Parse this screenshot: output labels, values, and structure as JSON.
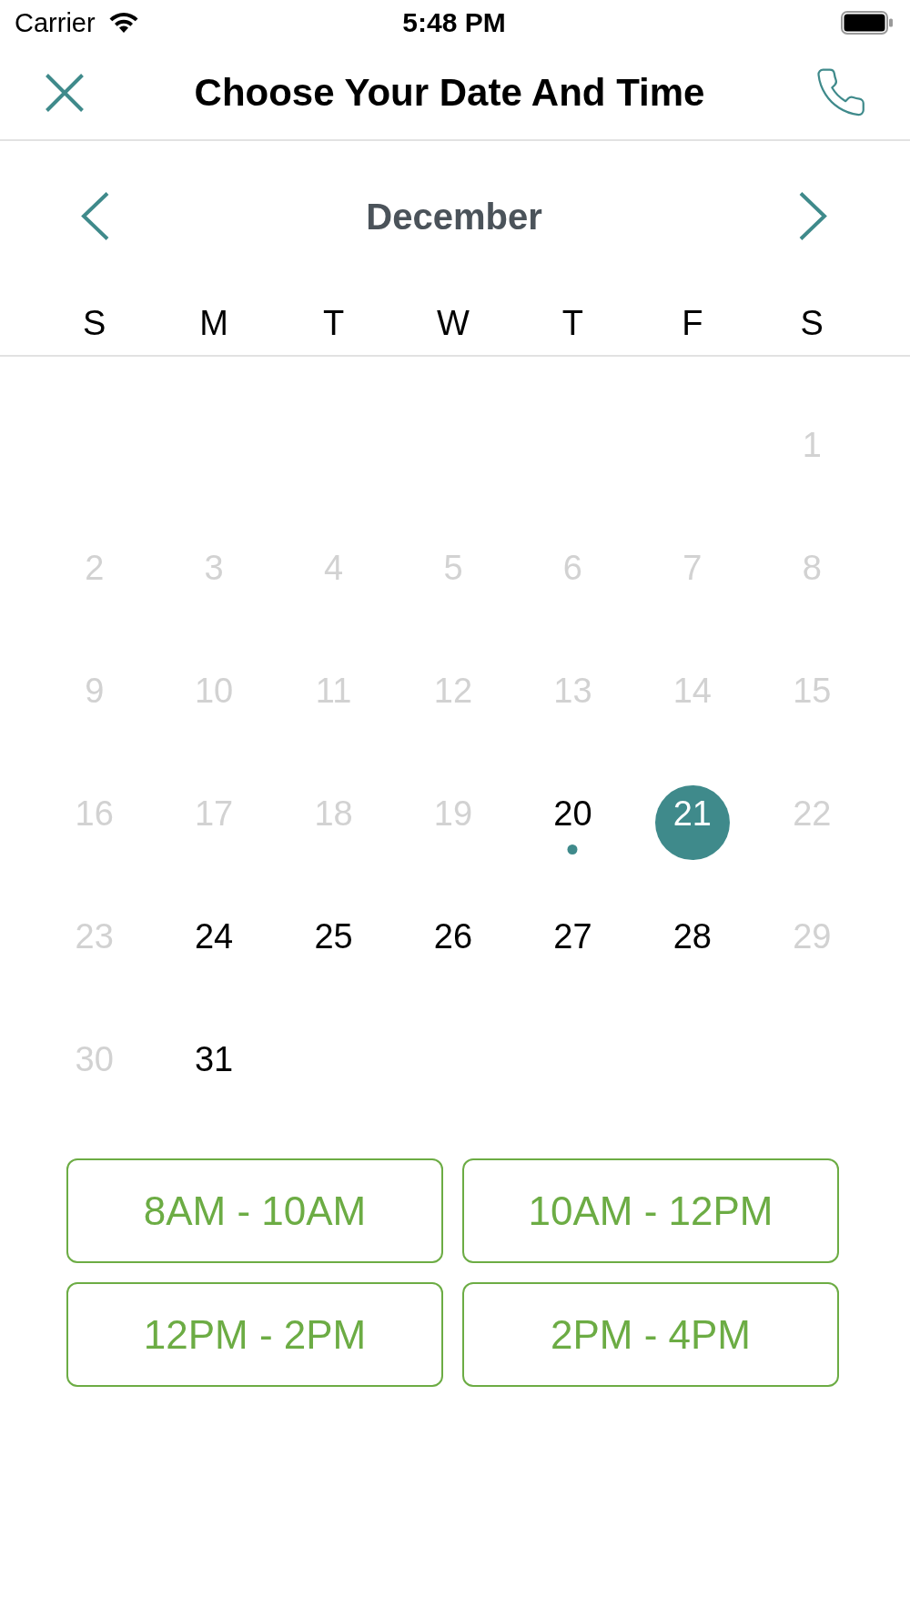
{
  "status_bar": {
    "carrier": "Carrier",
    "time": "5:48 PM"
  },
  "header": {
    "title": "Choose Your Date And Time"
  },
  "calendar": {
    "month": "December",
    "weekdays": [
      "S",
      "M",
      "T",
      "W",
      "T",
      "F",
      "S"
    ],
    "weeks": [
      {
        "days": [
          {
            "label": "1",
            "disabled": true,
            "selected": false,
            "today": false
          }
        ]
      },
      {
        "days": [
          {
            "label": "2",
            "disabled": true,
            "selected": false,
            "today": false
          },
          {
            "label": "3",
            "disabled": true,
            "selected": false,
            "today": false
          },
          {
            "label": "4",
            "disabled": true,
            "selected": false,
            "today": false
          },
          {
            "label": "5",
            "disabled": true,
            "selected": false,
            "today": false
          },
          {
            "label": "6",
            "disabled": true,
            "selected": false,
            "today": false
          },
          {
            "label": "7",
            "disabled": true,
            "selected": false,
            "today": false
          },
          {
            "label": "8",
            "disabled": true,
            "selected": false,
            "today": false
          }
        ]
      },
      {
        "days": [
          {
            "label": "9",
            "disabled": true,
            "selected": false,
            "today": false
          },
          {
            "label": "10",
            "disabled": true,
            "selected": false,
            "today": false
          },
          {
            "label": "11",
            "disabled": true,
            "selected": false,
            "today": false
          },
          {
            "label": "12",
            "disabled": true,
            "selected": false,
            "today": false
          },
          {
            "label": "13",
            "disabled": true,
            "selected": false,
            "today": false
          },
          {
            "label": "14",
            "disabled": true,
            "selected": false,
            "today": false
          },
          {
            "label": "15",
            "disabled": true,
            "selected": false,
            "today": false
          }
        ]
      },
      {
        "days": [
          {
            "label": "16",
            "disabled": true,
            "selected": false,
            "today": false
          },
          {
            "label": "17",
            "disabled": true,
            "selected": false,
            "today": false
          },
          {
            "label": "18",
            "disabled": true,
            "selected": false,
            "today": false
          },
          {
            "label": "19",
            "disabled": true,
            "selected": false,
            "today": false
          },
          {
            "label": "20",
            "disabled": false,
            "selected": false,
            "today": true
          },
          {
            "label": "21",
            "disabled": false,
            "selected": true,
            "today": false
          },
          {
            "label": "22",
            "disabled": true,
            "selected": false,
            "today": false
          }
        ]
      },
      {
        "days": [
          {
            "label": "23",
            "disabled": true,
            "selected": false,
            "today": false
          },
          {
            "label": "24",
            "disabled": false,
            "selected": false,
            "today": false
          },
          {
            "label": "25",
            "disabled": false,
            "selected": false,
            "today": false
          },
          {
            "label": "26",
            "disabled": false,
            "selected": false,
            "today": false
          },
          {
            "label": "27",
            "disabled": false,
            "selected": false,
            "today": false
          },
          {
            "label": "28",
            "disabled": false,
            "selected": false,
            "today": false
          },
          {
            "label": "29",
            "disabled": true,
            "selected": false,
            "today": false
          }
        ]
      },
      {
        "days": [
          {
            "label": "30",
            "disabled": true,
            "selected": false,
            "today": false
          },
          {
            "label": "31",
            "disabled": false,
            "selected": false,
            "today": false
          }
        ]
      }
    ]
  },
  "time_slots": [
    {
      "label": "8AM - 10AM",
      "selected": false
    },
    {
      "label": "10AM - 12PM",
      "selected": false
    },
    {
      "label": "12PM - 2PM",
      "selected": false
    },
    {
      "label": "2PM - 4PM",
      "selected": false
    }
  ]
}
